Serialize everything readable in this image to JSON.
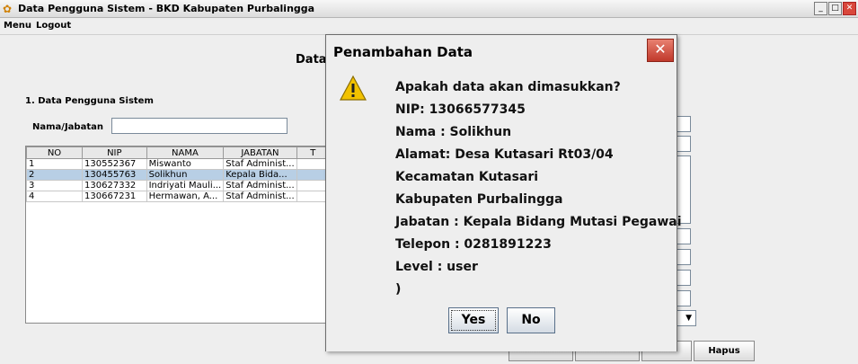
{
  "window": {
    "title": "Data Pengguna Sistem - BKD Kabupaten Purbalingga"
  },
  "menu": {
    "items": [
      "Menu",
      "Logout"
    ]
  },
  "form": {
    "heading": "Data",
    "section_label": "1. Data Pengguna Sistem",
    "search_label": "Nama/Jabatan",
    "search_value": "",
    "delete_button": "Hapus"
  },
  "table": {
    "columns": [
      "NO",
      "NIP",
      "NAMA",
      "JABATAN",
      "T"
    ],
    "rows": [
      [
        "1",
        "130552367",
        "Miswanto",
        "Staf Administ..."
      ],
      [
        "2",
        "130455763",
        "Solikhun",
        "Kepala Bida..."
      ],
      [
        "3",
        "130627332",
        "Indriyati Mauli...",
        "Staf Administ..."
      ],
      [
        "4",
        "130667231",
        "Hermawan, A...",
        "Staf Administ..."
      ]
    ],
    "selected_row": 1
  },
  "dialog": {
    "title": "Penambahan Data",
    "lines": [
      "Apakah data akan dimasukkan?",
      "NIP: 13066577345",
      "Nama : Solikhun",
      "Alamat: Desa Kutasari Rt03/04",
      "Kecamatan Kutasari",
      "Kabupaten Purbalingga",
      "Jabatan : Kepala Bidang Mutasi Pegawai",
      "Telepon : 0281891223",
      "Level : user",
      ")"
    ],
    "yes_label": "Yes",
    "no_label": "No"
  },
  "colors": {
    "selection": "#b8cfe5",
    "close_button": "#c0392b",
    "warning": "#f2c200"
  },
  "icons": {
    "app": "app-icon",
    "warning": "warning-icon",
    "close": "close-icon"
  }
}
